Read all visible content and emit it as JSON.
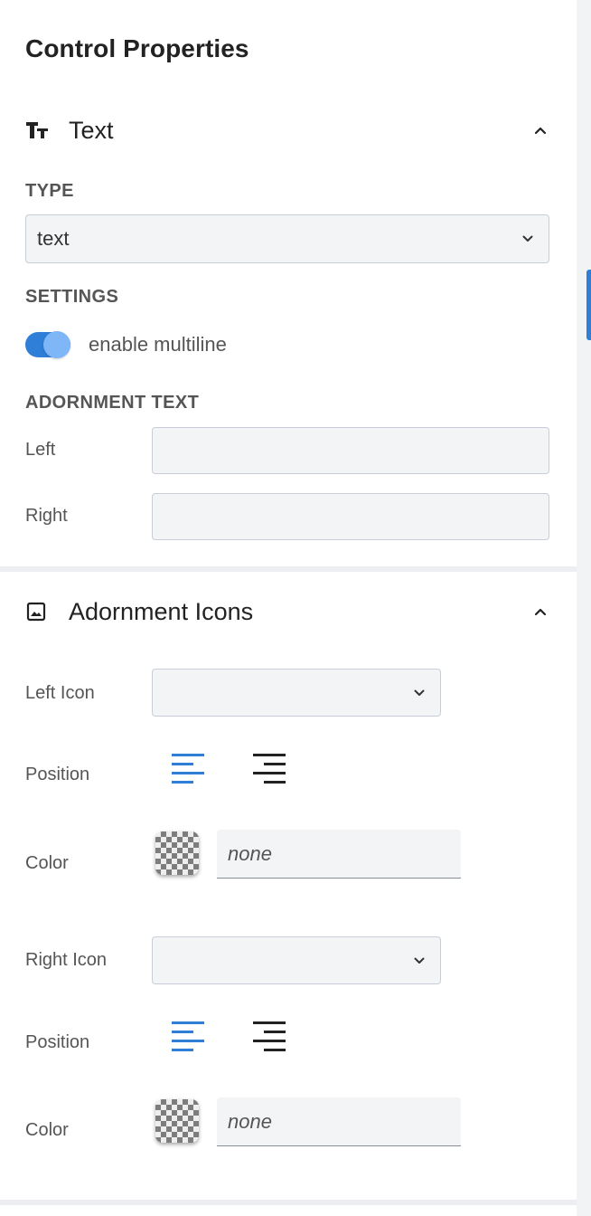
{
  "panel": {
    "title": "Control Properties"
  },
  "text_section": {
    "title": "Text",
    "icon": "text-format-icon",
    "type": {
      "label": "TYPE",
      "value": "text"
    },
    "settings": {
      "label": "SETTINGS",
      "multiline_label": "enable multiline",
      "multiline_enabled": true
    },
    "adornment_text": {
      "label": "ADORNMENT TEXT",
      "left_label": "Left",
      "left_value": "",
      "right_label": "Right",
      "right_value": ""
    }
  },
  "icons_section": {
    "title": "Adornment Icons",
    "icon": "image-icon",
    "left_icon": {
      "label": "Left Icon",
      "value": "",
      "position_label": "Position",
      "position": "left",
      "color_label": "Color",
      "color_placeholder": "none"
    },
    "right_icon": {
      "label": "Right Icon",
      "value": "",
      "position_label": "Position",
      "position": "left",
      "color_label": "Color",
      "color_placeholder": "none"
    }
  },
  "colors": {
    "accent": "#2f7fd8",
    "text": "#222222",
    "muted": "#555555",
    "field_bg": "#f3f4f6",
    "field_border": "#c9cdd8"
  }
}
